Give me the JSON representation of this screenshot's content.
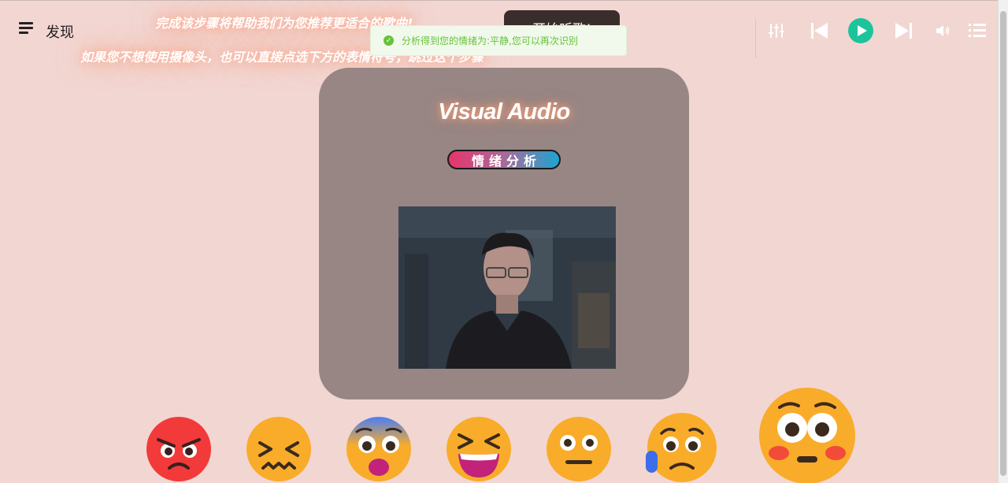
{
  "nav": {
    "discover_label": "发现"
  },
  "hints": {
    "line1": "完成该步骤将帮助我们为您推荐更适合的歌曲!",
    "line2": "如果您不想使用摄像头，也可以直接点选下方的表情符号，跳过这个步骤"
  },
  "start_button": "开始听歌!",
  "toast": {
    "message": "分析得到您的情绪为:平静,您可以再次识别"
  },
  "card": {
    "title": "Visual Audio",
    "analyze_button": "情绪分析"
  },
  "player_controls": [
    "equalizer-icon",
    "previous-icon",
    "play-icon",
    "next-icon",
    "volume-icon",
    "playlist-icon"
  ],
  "emojis": [
    "angry",
    "confounded",
    "fearful",
    "laughing",
    "neutral",
    "sad",
    "flushed"
  ],
  "colors": {
    "accent": "#1dc49b",
    "background": "#f2d6d2",
    "card": "#978684",
    "toast_bg": "#f0f9eb",
    "toast_text": "#67c23a"
  }
}
